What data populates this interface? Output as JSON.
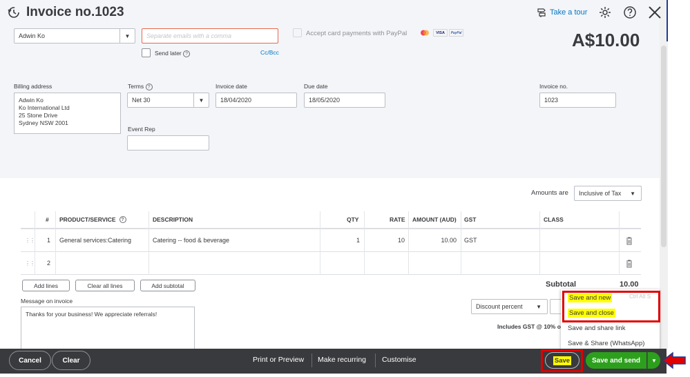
{
  "header": {
    "title": "Invoice no.1023",
    "take_tour": "Take a tour",
    "balance": "A$10.00"
  },
  "customer": {
    "name": "Adwin Ko",
    "email_placeholder": "Separate emails with a comma",
    "send_later": "Send later",
    "cc_bcc": "Cc/Bcc",
    "paypal_label": "Accept card payments with PayPal",
    "card_badges": [
      "VISA",
      "PayPal"
    ]
  },
  "billing": {
    "label": "Billing address",
    "lines": [
      "Adwin Ko",
      "Ko International Ltd",
      "25 Stone Drive",
      "Sydney NSW  2001"
    ]
  },
  "terms": {
    "label": "Terms",
    "value": "Net 30"
  },
  "invoice_date": {
    "label": "Invoice date",
    "value": "18/04/2020"
  },
  "due_date": {
    "label": "Due date",
    "value": "18/05/2020"
  },
  "invoice_no": {
    "label": "Invoice no.",
    "value": "1023"
  },
  "event_rep": {
    "label": "Event Rep",
    "value": ""
  },
  "amounts_are": {
    "label": "Amounts are",
    "value": "Inclusive of Tax"
  },
  "table": {
    "headers": [
      "#",
      "PRODUCT/SERVICE",
      "DESCRIPTION",
      "QTY",
      "RATE",
      "AMOUNT (AUD)",
      "GST",
      "CLASS"
    ],
    "rows": [
      {
        "num": "1",
        "product": "General services:Catering",
        "description": "Catering -- food & beverage",
        "qty": "1",
        "rate": "10",
        "amount": "10.00",
        "gst": "GST",
        "class": ""
      },
      {
        "num": "2",
        "product": "",
        "description": "",
        "qty": "",
        "rate": "",
        "amount": "",
        "gst": "",
        "class": ""
      }
    ]
  },
  "table_buttons": {
    "add_lines": "Add lines",
    "clear_all_lines": "Clear all lines",
    "add_subtotal": "Add subtotal"
  },
  "totals": {
    "subtotal_label": "Subtotal",
    "subtotal_value": "10.00",
    "discount": "Discount percent",
    "gst_note": "Includes GST @ 10% o"
  },
  "message": {
    "label": "Message on invoice",
    "value": "Thanks for your business!  We appreciate referrals!"
  },
  "save_menu": {
    "items": [
      "Save and new",
      "Save and close",
      "Save and share link",
      "Save & Share (WhatsApp)"
    ],
    "shortcut": "Ctrl Alt S"
  },
  "footer": {
    "cancel": "Cancel",
    "clear": "Clear",
    "print_preview": "Print or Preview",
    "make_recurring": "Make recurring",
    "customise": "Customise",
    "save": "Save",
    "save_and_send": "Save and send"
  },
  "colors": {
    "accent_green": "#2ca01c",
    "link_blue": "#0077c5",
    "footer_bg": "#393a3d",
    "highlight": "#ffff00",
    "annotation_red": "#e00000"
  }
}
